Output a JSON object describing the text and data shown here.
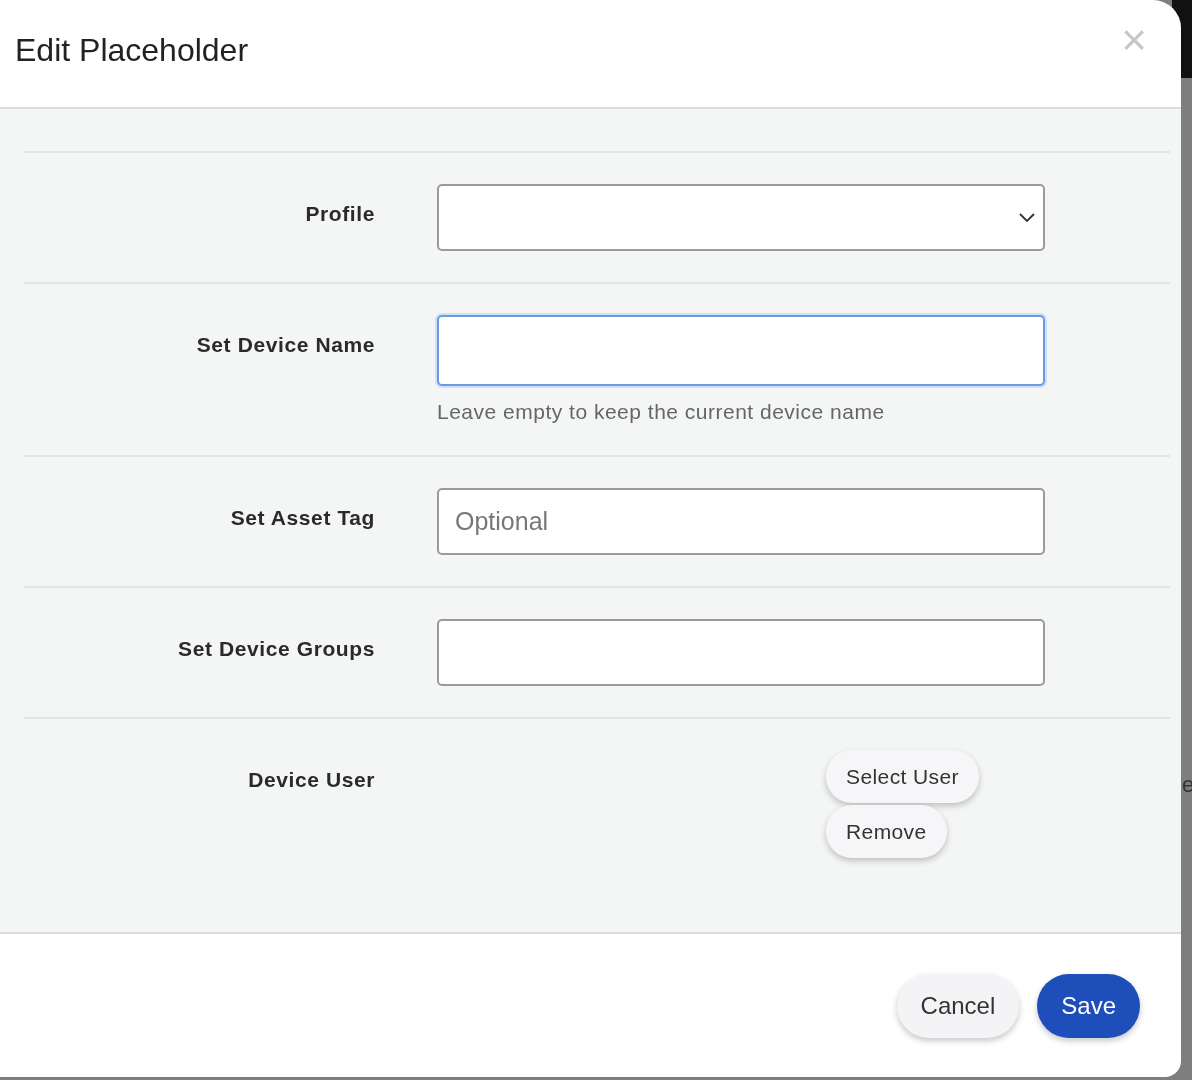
{
  "dialog": {
    "title": "Edit Placeholder",
    "close_glyph": "×"
  },
  "fields": [
    {
      "kind": "select",
      "label": "Profile",
      "focused": false
    },
    {
      "kind": "text",
      "label": "Set Device Name",
      "focused": true,
      "hint": "Leave empty to keep the current device name"
    },
    {
      "kind": "text",
      "label": "Set Asset Tag",
      "focused": false,
      "placeholder": "Optional"
    },
    {
      "kind": "text",
      "label": "Set Device Groups",
      "focused": false
    },
    {
      "kind": "buttons",
      "label": "Device User",
      "buttons": [
        "Select User",
        "Remove"
      ]
    }
  ],
  "footer": {
    "buttons": [
      {
        "label": "Cancel",
        "primary": false
      },
      {
        "label": "Save",
        "primary": true
      }
    ]
  },
  "background": {
    "text_fragment": "e"
  }
}
